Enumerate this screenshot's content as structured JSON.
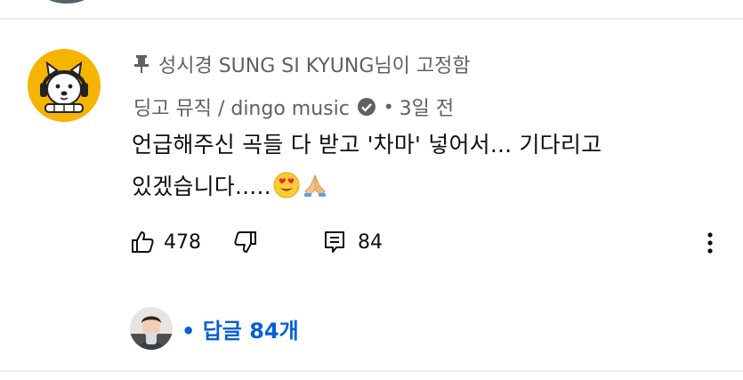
{
  "pinned": {
    "icon": "pin-icon",
    "text": "성시경 SUNG SI KYUNG님이 고정함"
  },
  "comment": {
    "author_avatar_icon": "dog-headphones-avatar",
    "author": "딩고 뮤직 / dingo music",
    "verified_icon": "verified-check-icon",
    "separator": "•",
    "time": "3일 전",
    "text_line1": "언급해주신 곡들 다 받고 '차마' 넣어서... 기다리고",
    "text_line2": "있겠습니다.....",
    "emojis": [
      "heart-eyes-emoji",
      "folded-hands-emoji"
    ]
  },
  "actions": {
    "like_icon": "thumbs-up-icon",
    "like_count": "478",
    "dislike_icon": "thumbs-down-icon",
    "reply_icon": "comment-reply-icon",
    "reply_count": "84",
    "more_icon": "more-vertical-icon"
  },
  "replies": {
    "avatar_icon": "replier-avatar",
    "separator": "•",
    "label": "답글 84개"
  },
  "colors": {
    "link_blue": "#065fd4",
    "avatar_yellow": "#f5b400",
    "secondary_text": "#606060",
    "divider": "#ececec"
  }
}
